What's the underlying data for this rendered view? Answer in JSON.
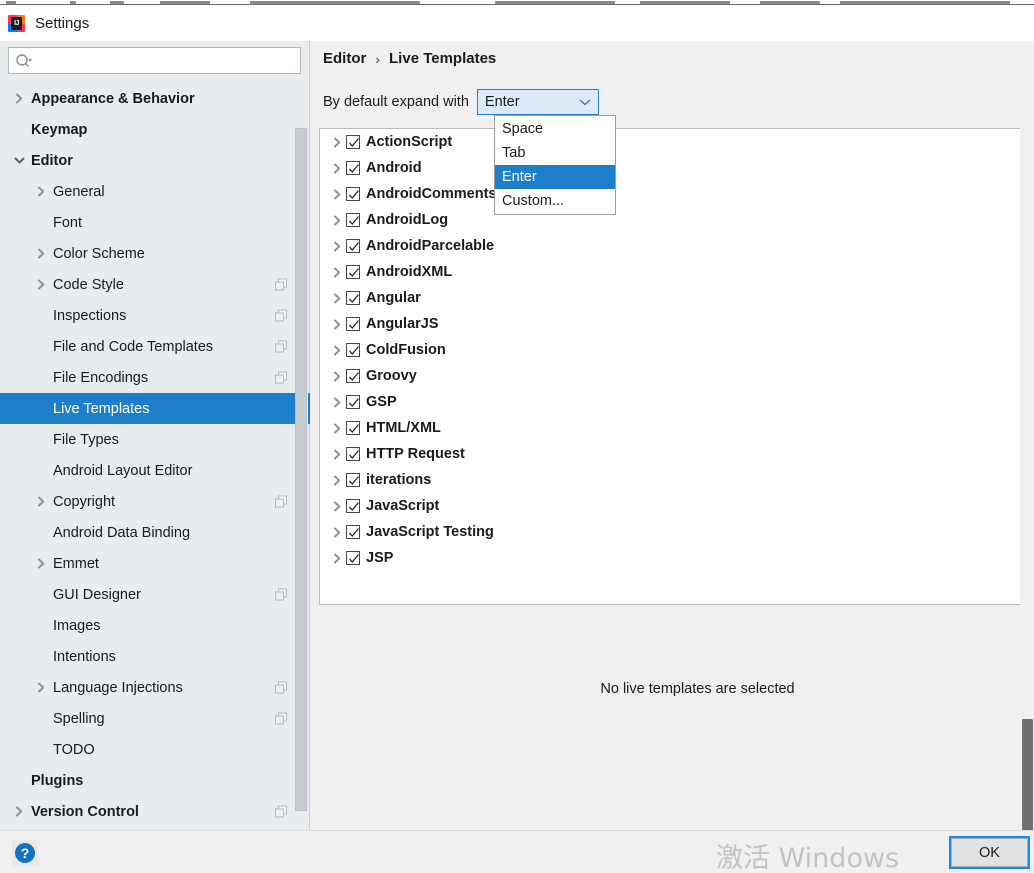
{
  "window": {
    "title": "Settings",
    "app_icon": "intellij-idea-icon",
    "icon_text": "IJ"
  },
  "search": {
    "value": "",
    "placeholder": "",
    "icon": "search-icon"
  },
  "sidebar": {
    "items": [
      {
        "label": "Appearance & Behavior",
        "indent": 0,
        "twisty": "collapsed",
        "bold": true,
        "badge": false,
        "selected": false
      },
      {
        "label": "Keymap",
        "indent": 0,
        "twisty": "none",
        "bold": true,
        "badge": false,
        "selected": false
      },
      {
        "label": "Editor",
        "indent": 0,
        "twisty": "expanded",
        "bold": true,
        "badge": false,
        "selected": false
      },
      {
        "label": "General",
        "indent": 1,
        "twisty": "collapsed",
        "bold": false,
        "badge": false,
        "selected": false
      },
      {
        "label": "Font",
        "indent": 1,
        "twisty": "none",
        "bold": false,
        "badge": false,
        "selected": false
      },
      {
        "label": "Color Scheme",
        "indent": 1,
        "twisty": "collapsed",
        "bold": false,
        "badge": false,
        "selected": false
      },
      {
        "label": "Code Style",
        "indent": 1,
        "twisty": "collapsed",
        "bold": false,
        "badge": true,
        "selected": false
      },
      {
        "label": "Inspections",
        "indent": 1,
        "twisty": "none",
        "bold": false,
        "badge": true,
        "selected": false
      },
      {
        "label": "File and Code Templates",
        "indent": 1,
        "twisty": "none",
        "bold": false,
        "badge": true,
        "selected": false
      },
      {
        "label": "File Encodings",
        "indent": 1,
        "twisty": "none",
        "bold": false,
        "badge": true,
        "selected": false
      },
      {
        "label": "Live Templates",
        "indent": 1,
        "twisty": "none",
        "bold": false,
        "badge": false,
        "selected": true
      },
      {
        "label": "File Types",
        "indent": 1,
        "twisty": "none",
        "bold": false,
        "badge": false,
        "selected": false
      },
      {
        "label": "Android Layout Editor",
        "indent": 1,
        "twisty": "none",
        "bold": false,
        "badge": false,
        "selected": false
      },
      {
        "label": "Copyright",
        "indent": 1,
        "twisty": "collapsed",
        "bold": false,
        "badge": true,
        "selected": false
      },
      {
        "label": "Android Data Binding",
        "indent": 1,
        "twisty": "none",
        "bold": false,
        "badge": false,
        "selected": false
      },
      {
        "label": "Emmet",
        "indent": 1,
        "twisty": "collapsed",
        "bold": false,
        "badge": false,
        "selected": false
      },
      {
        "label": "GUI Designer",
        "indent": 1,
        "twisty": "none",
        "bold": false,
        "badge": true,
        "selected": false
      },
      {
        "label": "Images",
        "indent": 1,
        "twisty": "none",
        "bold": false,
        "badge": false,
        "selected": false
      },
      {
        "label": "Intentions",
        "indent": 1,
        "twisty": "none",
        "bold": false,
        "badge": false,
        "selected": false
      },
      {
        "label": "Language Injections",
        "indent": 1,
        "twisty": "collapsed",
        "bold": false,
        "badge": true,
        "selected": false
      },
      {
        "label": "Spelling",
        "indent": 1,
        "twisty": "none",
        "bold": false,
        "badge": true,
        "selected": false
      },
      {
        "label": "TODO",
        "indent": 1,
        "twisty": "none",
        "bold": false,
        "badge": false,
        "selected": false
      },
      {
        "label": "Plugins",
        "indent": 0,
        "twisty": "none",
        "bold": true,
        "badge": false,
        "selected": false
      },
      {
        "label": "Version Control",
        "indent": 0,
        "twisty": "collapsed",
        "bold": true,
        "badge": true,
        "selected": false
      }
    ]
  },
  "main": {
    "breadcrumb": {
      "parent": "Editor",
      "separator": "›",
      "current": "Live Templates"
    },
    "expand_label": "By default expand with",
    "combo": {
      "selected": "Enter",
      "open": true,
      "options": [
        {
          "label": "Space",
          "selected": false
        },
        {
          "label": "Tab",
          "selected": false
        },
        {
          "label": "Enter",
          "selected": true
        },
        {
          "label": "Custom...",
          "selected": false
        }
      ]
    },
    "templates": [
      {
        "label": "ActionScript",
        "checked": true,
        "expandable": true
      },
      {
        "label": "Android",
        "checked": true,
        "expandable": true
      },
      {
        "label": "AndroidComments",
        "checked": true,
        "expandable": true
      },
      {
        "label": "AndroidLog",
        "checked": true,
        "expandable": true
      },
      {
        "label": "AndroidParcelable",
        "checked": true,
        "expandable": true
      },
      {
        "label": "AndroidXML",
        "checked": true,
        "expandable": true
      },
      {
        "label": "Angular",
        "checked": true,
        "expandable": true
      },
      {
        "label": "AngularJS",
        "checked": true,
        "expandable": true
      },
      {
        "label": "ColdFusion",
        "checked": true,
        "expandable": true
      },
      {
        "label": "Groovy",
        "checked": true,
        "expandable": true
      },
      {
        "label": "GSP",
        "checked": true,
        "expandable": true
      },
      {
        "label": "HTML/XML",
        "checked": true,
        "expandable": true
      },
      {
        "label": "HTTP Request",
        "checked": true,
        "expandable": true
      },
      {
        "label": "iterations",
        "checked": true,
        "expandable": true
      },
      {
        "label": "JavaScript",
        "checked": true,
        "expandable": true
      },
      {
        "label": "JavaScript Testing",
        "checked": true,
        "expandable": true
      },
      {
        "label": "JSP",
        "checked": true,
        "expandable": true
      }
    ],
    "empty_message": "No live templates are selected"
  },
  "footer": {
    "help_icon": "question-mark-icon",
    "help_glyph": "?",
    "watermark": "激活 Windows",
    "ok_label": "OK"
  },
  "colors": {
    "accent_blue": "#1d7fc9",
    "focus_blue": "#1b8ae8",
    "sidebar_bg": "#e8ecef",
    "panel_bg": "#f0f0f0",
    "combo_bg": "#dce9f7"
  }
}
